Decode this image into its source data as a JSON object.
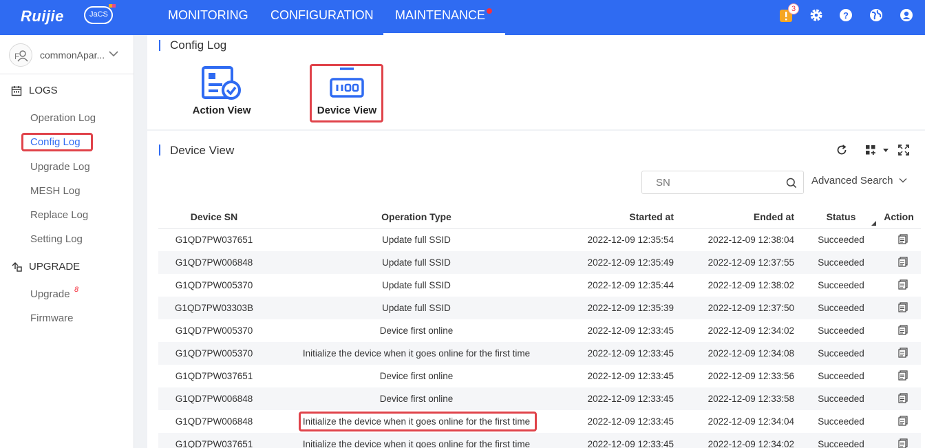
{
  "brand": {
    "logo_text": "Ruijie",
    "cloud_text": "JaCS"
  },
  "topnav": {
    "items": [
      {
        "label": "MONITORING"
      },
      {
        "label": "CONFIGURATION"
      },
      {
        "label": "MAINTENANCE"
      }
    ],
    "alert_count": "3"
  },
  "sidebar": {
    "user": "commonApar...",
    "groups": [
      {
        "label": "LOGS",
        "icon": "calendar-icon"
      },
      {
        "label": "UPGRADE",
        "icon": "upgrade-icon"
      }
    ],
    "logs_items": [
      "Operation Log",
      "Config Log",
      "Upgrade Log",
      "MESH Log",
      "Replace Log",
      "Setting Log"
    ],
    "upgrade_items": [
      "Upgrade",
      "Firmware"
    ],
    "upgrade_sup": "8"
  },
  "config_log": {
    "title": "Config Log",
    "views": [
      {
        "label": "Action View",
        "icon": "action-view-icon"
      },
      {
        "label": "Device View",
        "icon": "device-view-icon"
      }
    ]
  },
  "device_view": {
    "title": "Device View",
    "search_placeholder": "SN",
    "advanced_search": "Advanced Search",
    "columns": [
      "Device SN",
      "Operation Type",
      "Started at",
      "Ended at",
      "Status",
      "Action"
    ],
    "rows": [
      {
        "sn": "G1QD7PW037651",
        "op": "Update full SSID",
        "start": "2022-12-09 12:35:54",
        "end": "2022-12-09 12:38:04",
        "status": "Succeeded"
      },
      {
        "sn": "G1QD7PW006848",
        "op": "Update full SSID",
        "start": "2022-12-09 12:35:49",
        "end": "2022-12-09 12:37:55",
        "status": "Succeeded"
      },
      {
        "sn": "G1QD7PW005370",
        "op": "Update full SSID",
        "start": "2022-12-09 12:35:44",
        "end": "2022-12-09 12:38:02",
        "status": "Succeeded"
      },
      {
        "sn": "G1QD7PW03303B",
        "op": "Update full SSID",
        "start": "2022-12-09 12:35:39",
        "end": "2022-12-09 12:37:50",
        "status": "Succeeded"
      },
      {
        "sn": "G1QD7PW005370",
        "op": "Device first online",
        "start": "2022-12-09 12:33:45",
        "end": "2022-12-09 12:34:02",
        "status": "Succeeded"
      },
      {
        "sn": "G1QD7PW005370",
        "op": "Initialize the device when it goes online for the first time",
        "start": "2022-12-09 12:33:45",
        "end": "2022-12-09 12:34:08",
        "status": "Succeeded"
      },
      {
        "sn": "G1QD7PW037651",
        "op": "Device first online",
        "start": "2022-12-09 12:33:45",
        "end": "2022-12-09 12:33:56",
        "status": "Succeeded"
      },
      {
        "sn": "G1QD7PW006848",
        "op": "Device first online",
        "start": "2022-12-09 12:33:45",
        "end": "2022-12-09 12:33:58",
        "status": "Succeeded"
      },
      {
        "sn": "G1QD7PW006848",
        "op": "Initialize the device when it goes online for the first time",
        "start": "2022-12-09 12:33:45",
        "end": "2022-12-09 12:34:04",
        "status": "Succeeded"
      },
      {
        "sn": "G1QD7PW037651",
        "op": "Initialize the device when it goes online for the first time",
        "start": "2022-12-09 12:33:45",
        "end": "2022-12-09 12:34:02",
        "status": "Succeeded"
      }
    ]
  },
  "colors": {
    "primary": "#2f6bf2",
    "highlight": "#e0434a",
    "alert": "#f5313e",
    "warning": "#f5a623"
  }
}
